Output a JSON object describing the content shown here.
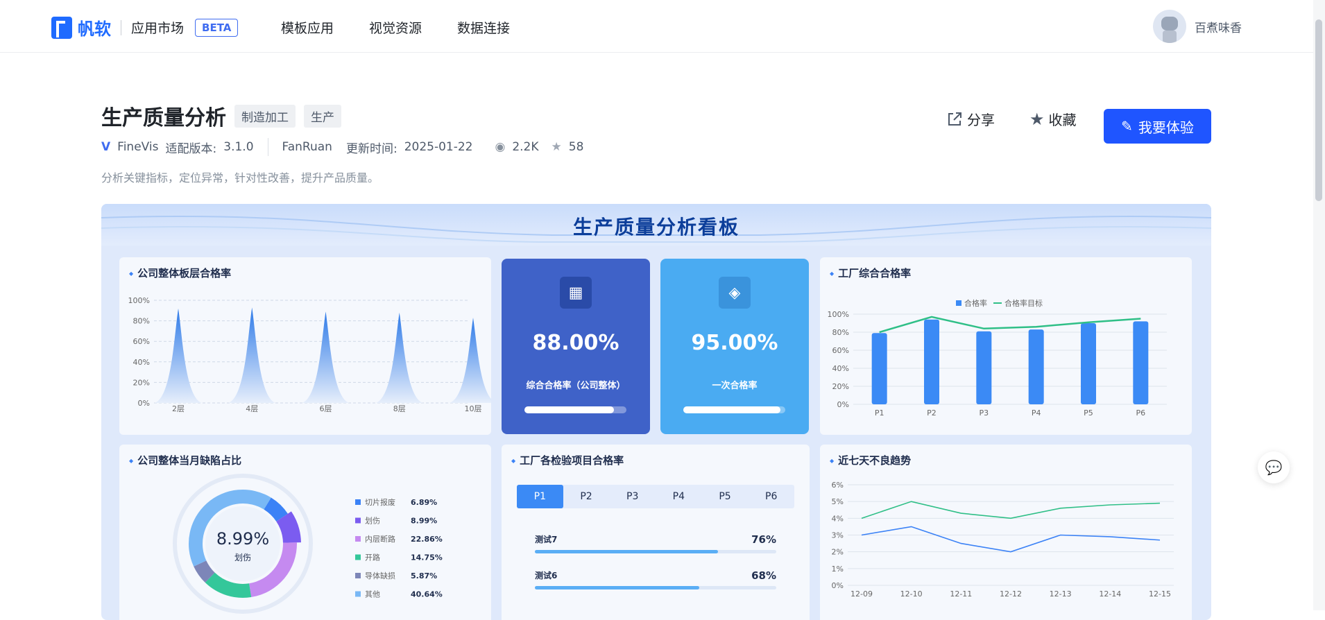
{
  "header": {
    "brand": "帆软",
    "market": "应用市场",
    "beta": "BETA",
    "nav": [
      "模板应用",
      "视觉资源",
      "数据连接"
    ],
    "user_name": "百煮味香"
  },
  "product": {
    "title": "生产质量分析",
    "tags": [
      "制造加工",
      "生产"
    ],
    "platform": "FineVis",
    "version_label": "适配版本:",
    "version": "3.1.0",
    "author": "FanRuan",
    "update_label": "更新时间:",
    "update_date": "2025-01-22",
    "views": "2.2K",
    "stars": "58",
    "description": "分析关键指标，定位异常，针对性改善，提升产品质量。"
  },
  "actions": {
    "share": "分享",
    "favorite": "收藏",
    "try": "我要体验"
  },
  "dashboard": {
    "title": "生产质量分析看板",
    "panel1_title": "公司整体板层合格率",
    "panel2_title": "工厂综合合格率",
    "panel3_title": "公司整体当月缺陷占比",
    "panel4_title": "工厂各检验项目合格率",
    "panel5_title": "近七天不良趋势",
    "kpi1": {
      "value": "88.00%",
      "label": "综合合格率（公司整体）",
      "progress": 0.88
    },
    "kpi2": {
      "value": "95.00%",
      "label": "一次合格率",
      "progress": 0.95
    },
    "donut": {
      "value": "8.99%",
      "label": "划伤"
    },
    "tabs": [
      "P1",
      "P2",
      "P3",
      "P4",
      "P5",
      "P6"
    ],
    "bars_p1": [
      {
        "name": "测试7",
        "value": "76%",
        "pct": 76
      },
      {
        "name": "测试6",
        "value": "68%",
        "pct": 68
      }
    ]
  },
  "chart_data": [
    {
      "type": "area",
      "categories": [
        "2层",
        "4层",
        "6层",
        "8层",
        "10层"
      ],
      "values": [
        92,
        93,
        89,
        88,
        83
      ],
      "ylim": [
        0,
        100
      ],
      "yticks": [
        "0%",
        "20%",
        "40%",
        "60%",
        "80%",
        "100%"
      ]
    },
    {
      "type": "bar",
      "categories": [
        "P1",
        "P2",
        "P3",
        "P4",
        "P5",
        "P6"
      ],
      "series": [
        {
          "name": "合格率",
          "values": [
            79,
            94,
            81,
            83,
            90,
            92
          ]
        },
        {
          "name": "合格率目标",
          "values": [
            80,
            97,
            84,
            86,
            91,
            95
          ]
        }
      ],
      "ylim": [
        0,
        100
      ],
      "yticks": [
        "0%",
        "20%",
        "40%",
        "60%",
        "80%",
        "100%"
      ]
    },
    {
      "type": "pie",
      "labels": [
        "切片报废",
        "划伤",
        "内层断路",
        "开路",
        "导体缺损",
        "其他"
      ],
      "values": [
        6.89,
        8.99,
        22.86,
        14.75,
        5.87,
        40.64
      ],
      "value_labels": [
        "6.89%",
        "8.99%",
        "22.86%",
        "14.75%",
        "5.87%",
        "40.64%"
      ],
      "colors": [
        "#3b82f6",
        "#7b5cf0",
        "#c58af0",
        "#34c79a",
        "#7d86b8",
        "#79b8f5"
      ]
    },
    {
      "type": "line",
      "categories": [
        "12-09",
        "12-10",
        "12-11",
        "12-12",
        "12-13",
        "12-14",
        "12-15"
      ],
      "series": [
        {
          "values": [
            4.0,
            5.0,
            4.3,
            4.0,
            4.6,
            4.8,
            4.9
          ]
        },
        {
          "values": [
            3.0,
            3.5,
            2.5,
            2.0,
            3.0,
            2.9,
            2.7
          ]
        }
      ],
      "ylim": [
        0,
        6
      ],
      "yticks": [
        "0%",
        "1%",
        "2%",
        "3%",
        "4%",
        "5%",
        "6%"
      ]
    }
  ]
}
